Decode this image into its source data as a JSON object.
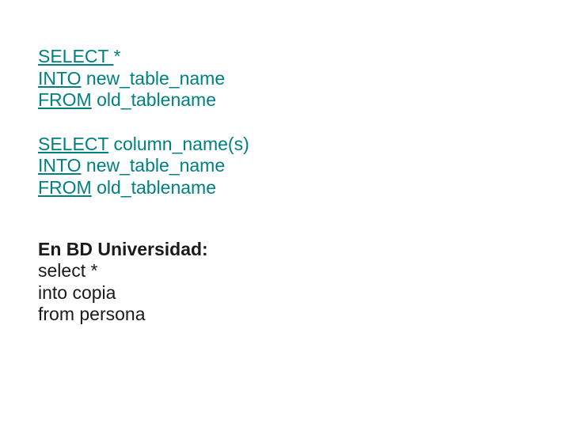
{
  "syntax1": {
    "line1_kw": "SELECT ",
    "line1_rest": "*",
    "line2_kw": "INTO",
    "line2_sp": " ",
    "line2_rest": "new_table_name",
    "line3_kw": "FROM",
    "line3_sp": " ",
    "line3_rest": "old_tablename"
  },
  "syntax2": {
    "line1_kw": "SELECT",
    "line1_sp": " ",
    "line1_rest": "column_name(s)",
    "line2_kw": "INTO",
    "line2_sp": " ",
    "line2_rest": "new_table_name",
    "line3_kw": "FROM",
    "line3_sp": " ",
    "line3_rest": "old_tablename"
  },
  "example": {
    "heading": "En BD Universidad:",
    "line1": "select *",
    "line2": "into copia",
    "line3": "from persona"
  }
}
